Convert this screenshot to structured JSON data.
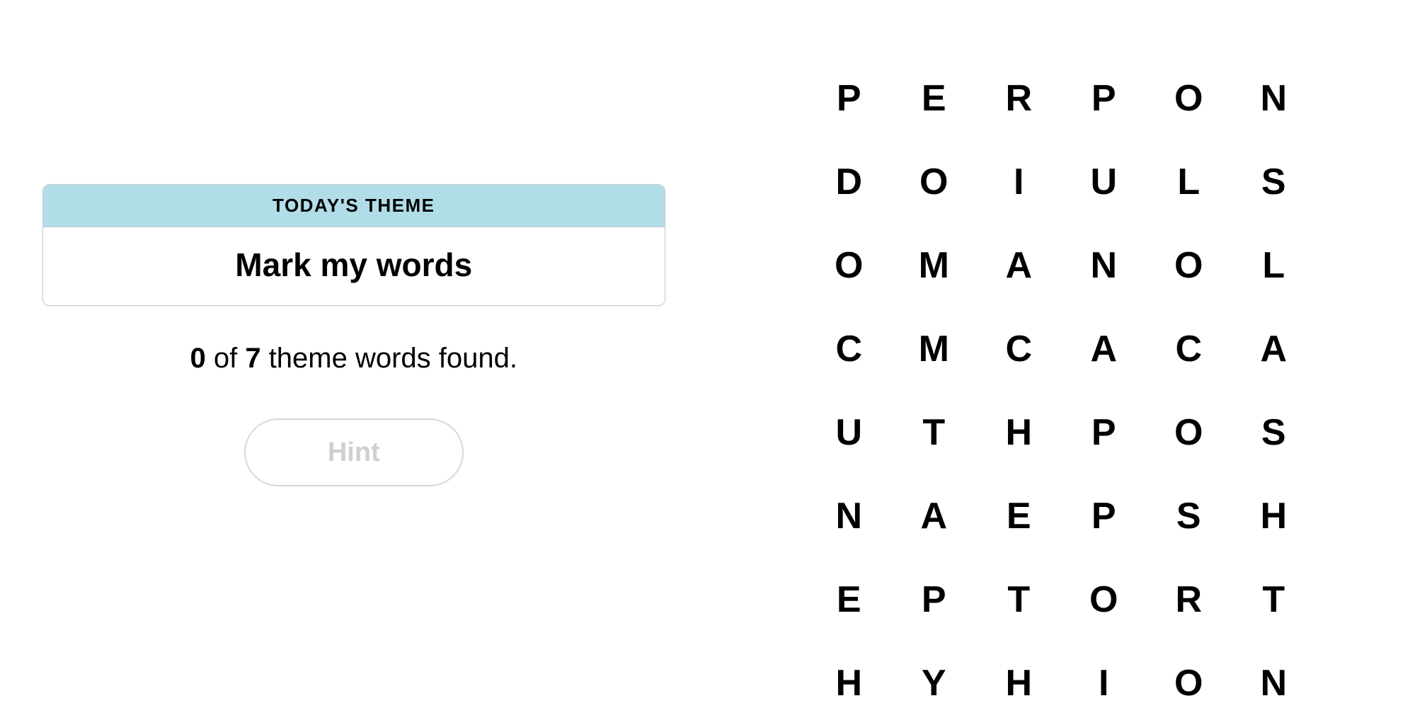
{
  "theme": {
    "header_label": "TODAY'S THEME",
    "title": "Mark my words"
  },
  "progress": {
    "found": "0",
    "separator": " of ",
    "total": "7",
    "suffix": " theme words found."
  },
  "hint": {
    "label": "Hint"
  },
  "grid": {
    "rows": [
      [
        "P",
        "E",
        "R",
        "P",
        "O",
        "N"
      ],
      [
        "D",
        "O",
        "I",
        "U",
        "L",
        "S"
      ],
      [
        "O",
        "M",
        "A",
        "N",
        "O",
        "L"
      ],
      [
        "C",
        "M",
        "C",
        "A",
        "C",
        "A"
      ],
      [
        "U",
        "T",
        "H",
        "P",
        "O",
        "S"
      ],
      [
        "N",
        "A",
        "E",
        "P",
        "S",
        "H"
      ],
      [
        "E",
        "P",
        "T",
        "O",
        "R",
        "T"
      ],
      [
        "H",
        "Y",
        "H",
        "I",
        "O",
        "N"
      ]
    ]
  }
}
